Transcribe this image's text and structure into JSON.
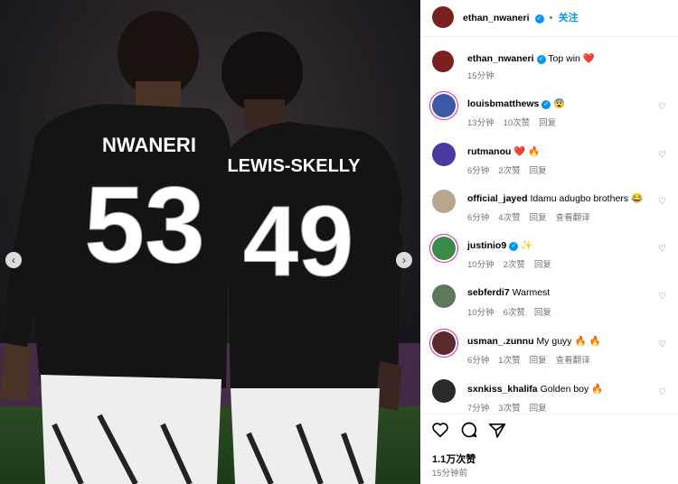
{
  "header": {
    "username": "ethan_nwaneri",
    "separator": "•",
    "follow_label": "关注"
  },
  "caption": {
    "username": "ethan_nwaneri",
    "text": "Top win",
    "emoji": "❤️",
    "time": "15分钟"
  },
  "comments": [
    {
      "user": "louisbmatthews",
      "verified": true,
      "text": "",
      "emoji": "😨",
      "time": "13分钟",
      "likes": "10次赞",
      "reply": "回复",
      "translate": ""
    },
    {
      "user": "rutmanou",
      "verified": false,
      "text": "",
      "emoji": "❤️ 🔥",
      "time": "6分钟",
      "likes": "2次赞",
      "reply": "回复",
      "translate": ""
    },
    {
      "user": "official_jayed",
      "verified": false,
      "text": "Idamu adugbo brothers",
      "emoji": "😂",
      "time": "6分钟",
      "likes": "4次赞",
      "reply": "回复",
      "translate": "查看翻译"
    },
    {
      "user": "justinio9",
      "verified": true,
      "text": "",
      "emoji": "✨",
      "time": "10分钟",
      "likes": "2次赞",
      "reply": "回复",
      "translate": ""
    },
    {
      "user": "sebferdi7",
      "verified": false,
      "text": "Warmest",
      "emoji": "",
      "time": "10分钟",
      "likes": "6次赞",
      "reply": "回复",
      "translate": ""
    },
    {
      "user": "usman_.zunnu",
      "verified": false,
      "text": "My guyy",
      "emoji": "🔥 🔥",
      "time": "6分钟",
      "likes": "1次赞",
      "reply": "回复",
      "translate": "查看翻译"
    },
    {
      "user": "sxnkiss_khalifa",
      "verified": false,
      "text": "Golden boy",
      "emoji": "🔥",
      "time": "7分钟",
      "likes": "3次赞",
      "reply": "回复",
      "translate": ""
    }
  ],
  "footer": {
    "likes": "1.1万次赞",
    "time": "15分钟前"
  },
  "photo": {
    "left_name": "NWANERI",
    "left_number": "53",
    "right_name": "LEWIS-SKELLY",
    "right_number": "49"
  },
  "icons": {
    "like": "heart-icon",
    "comment": "comment-icon",
    "share": "share-icon",
    "prev": "chevron-left-icon",
    "next": "chevron-right-icon"
  },
  "colors": {
    "accent": "#0095f6",
    "like_red": "#ed4956",
    "shirt": "#111111"
  }
}
